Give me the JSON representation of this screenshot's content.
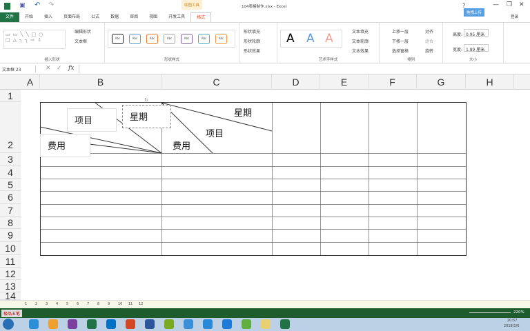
{
  "window": {
    "title": "104表格制作.xlsx - Excel",
    "context_tab": "绘图工具",
    "login": "登录",
    "upload": "拖拽上传"
  },
  "tabs": [
    "文件",
    "开始",
    "插入",
    "页面布局",
    "公式",
    "数据",
    "审阅",
    "视图",
    "开发工具",
    "格式"
  ],
  "ribbon": {
    "insert_shapes": {
      "label": "插入形状",
      "edit_shape": "编辑形状",
      "text_box": "文本框"
    },
    "shape_styles": {
      "label": "形状样式",
      "sample": "Abc",
      "colors": [
        "#222222",
        "#5b9bd5",
        "#ed7d31",
        "#a5a5a5",
        "#8064a2",
        "#4bacc6",
        "#f79646"
      ],
      "fill": "形状填充",
      "outline": "形状轮廓",
      "effect": "形状效果"
    },
    "wordart": {
      "label": "艺术字样式",
      "letter": "A",
      "fill": "文本填充",
      "outline": "文本轮廓",
      "effect": "文本效果"
    },
    "arrange": {
      "label": "排列",
      "bring_forward": "上移一层",
      "send_backward": "下移一层",
      "selection_pane": "选择窗格",
      "align": "对齐",
      "group": "组合",
      "rotate": "旋转"
    },
    "size": {
      "label": "大小",
      "height_label": "高度:",
      "height": "0.95 厘米",
      "width_label": "宽度:",
      "width": "1.89 厘米"
    }
  },
  "formula_bar": {
    "name_box": "文本框 23",
    "fx": "fx",
    "value": ""
  },
  "columns": [
    "A",
    "B",
    "C",
    "D",
    "E",
    "F",
    "G",
    "H"
  ],
  "rows": [
    "1",
    "2",
    "3",
    "4",
    "5",
    "6",
    "7",
    "8",
    "9",
    "10",
    "11",
    "12",
    "13",
    "14"
  ],
  "cells": {
    "b_item": "项目",
    "b_cost": "费用",
    "b_week": "星期",
    "c_week": "星期",
    "c_item": "项目",
    "c_cost": "费用"
  },
  "sheet_tabs": [
    "1",
    "2",
    "3",
    "4",
    "5",
    "6",
    "7",
    "8",
    "9",
    "10",
    "11",
    "12"
  ],
  "status": {
    "zoom": "220%",
    "ime": "极品五笔"
  },
  "taskbar": {
    "time": "20:57",
    "date": "2018/2/6"
  }
}
